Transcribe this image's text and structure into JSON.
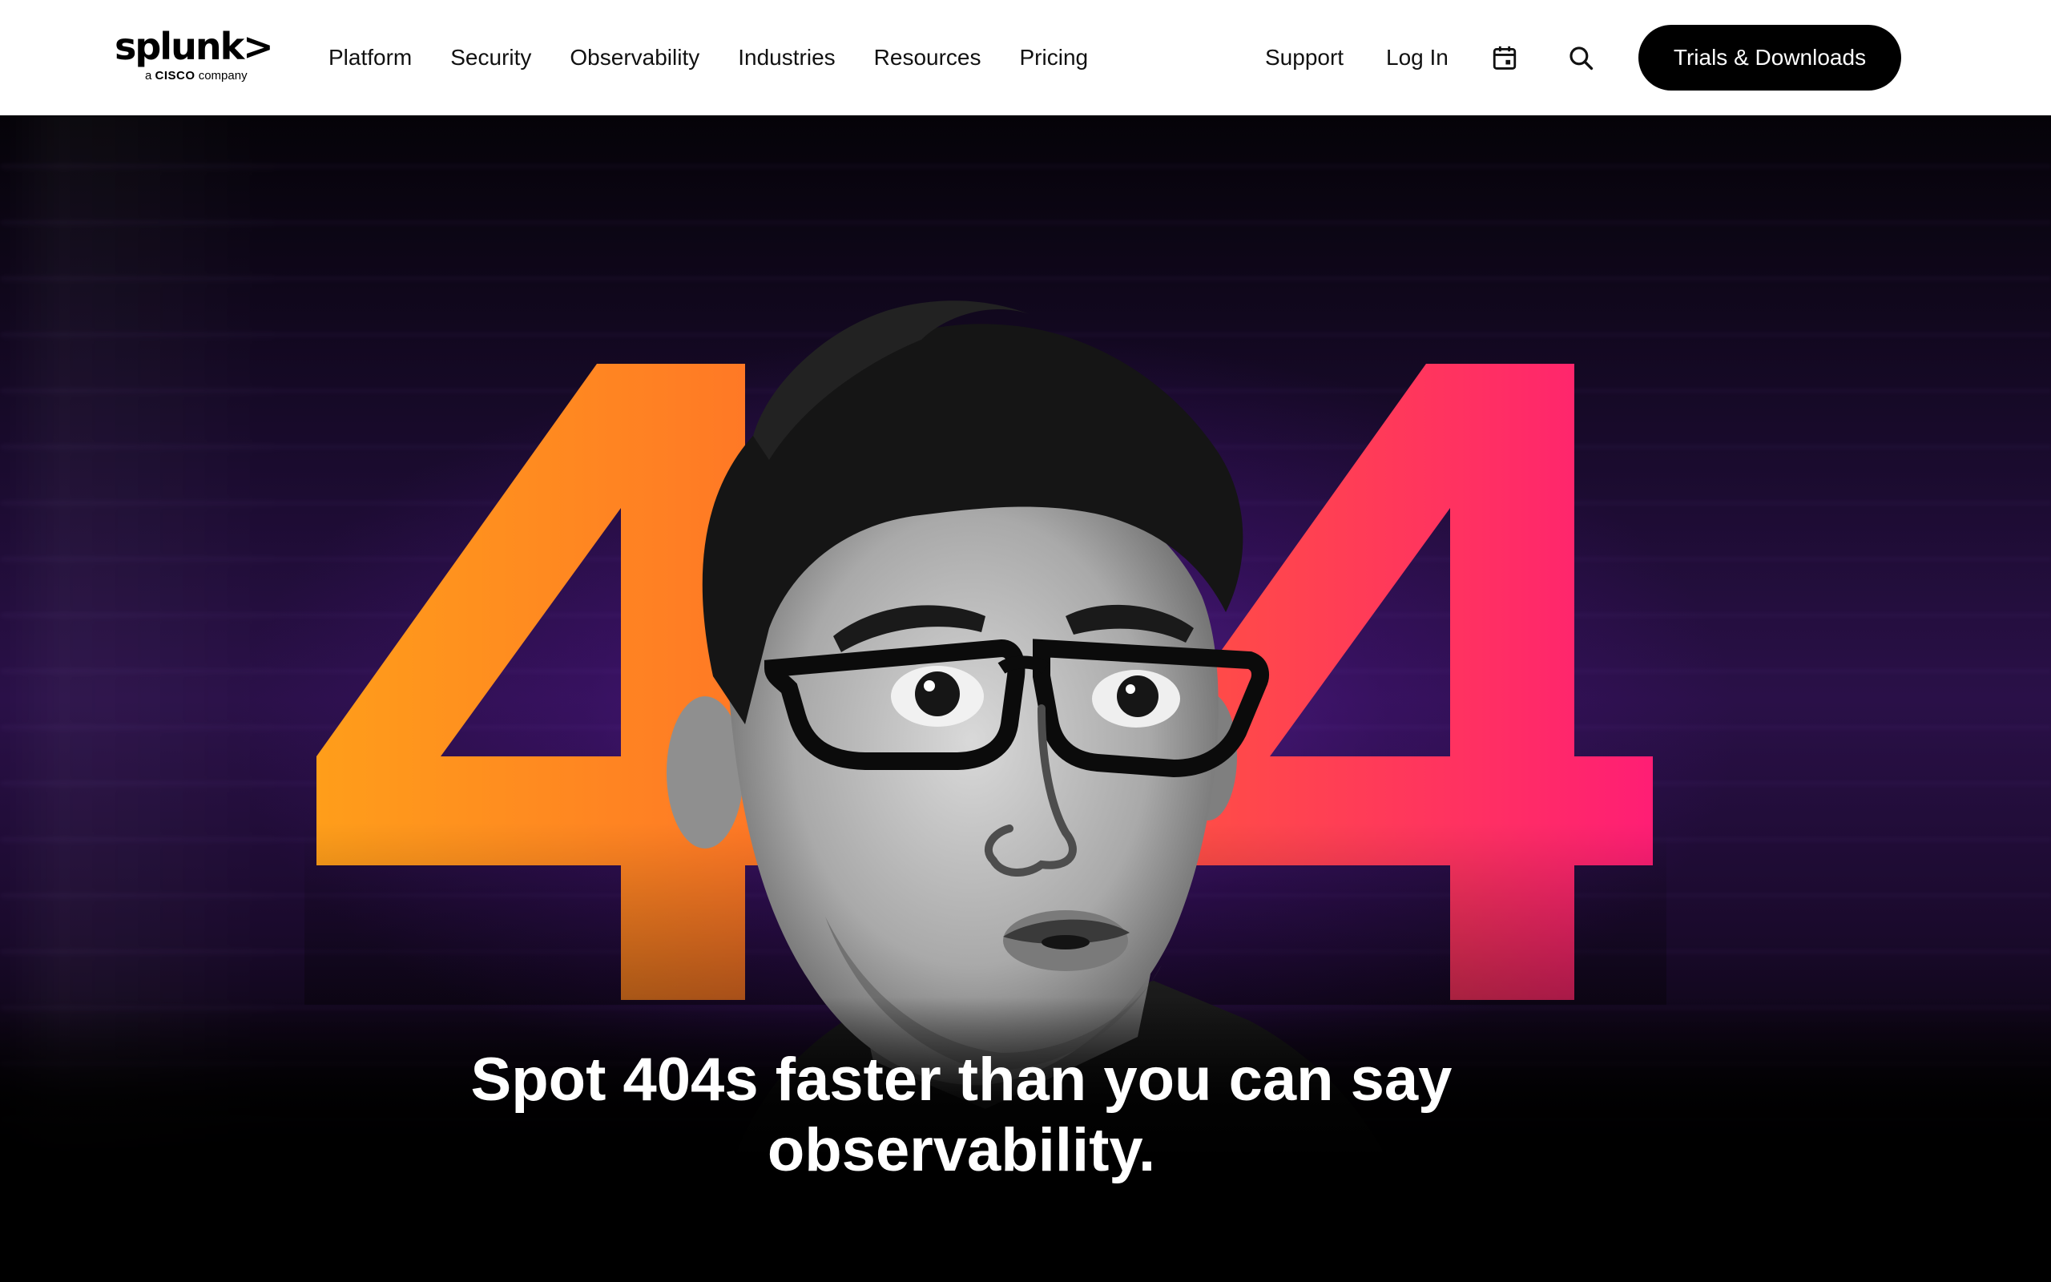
{
  "header": {
    "logo": {
      "word": "splunk>",
      "sub_prefix": "a ",
      "sub_brand": "CISCO",
      "sub_suffix": " company"
    },
    "nav": [
      {
        "label": "Platform"
      },
      {
        "label": "Security"
      },
      {
        "label": "Observability"
      },
      {
        "label": "Industries"
      },
      {
        "label": "Resources"
      },
      {
        "label": "Pricing"
      }
    ],
    "support_label": "Support",
    "login_label": "Log In",
    "calendar_icon": "calendar-icon",
    "search_icon": "search-icon",
    "cta_label": "Trials & Downloads"
  },
  "hero": {
    "error_code": "404",
    "headline": "Spot 404s faster than you can say observability.",
    "colors": {
      "gradient_start": "#FF9A1F",
      "gradient_end": "#FF1F74",
      "background": "#1A0B2E"
    }
  }
}
